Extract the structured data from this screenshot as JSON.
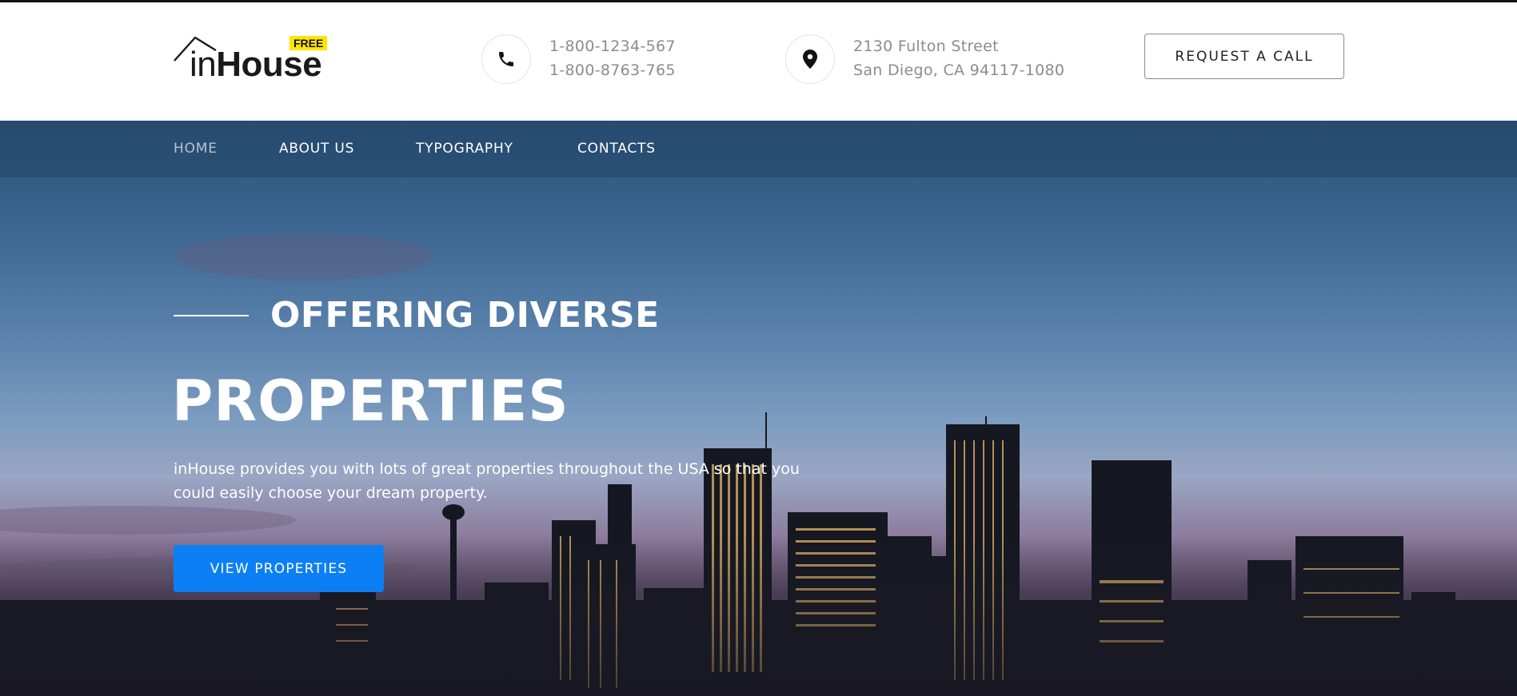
{
  "logo": {
    "light": "in",
    "bold": "House",
    "badge": "FREE"
  },
  "contact": {
    "phone_icon": "phone-icon",
    "phones": [
      "1-800-1234-567",
      "1-800-8763-765"
    ],
    "location_icon": "map-pin-icon",
    "address": [
      "2130 Fulton Street",
      "San Diego, CA 94117-1080"
    ]
  },
  "header": {
    "request_label": "REQUEST A CALL"
  },
  "nav": {
    "items": [
      {
        "label": "HOME",
        "active": true
      },
      {
        "label": "ABOUT US",
        "active": false
      },
      {
        "label": "TYPOGRAPHY",
        "active": false
      },
      {
        "label": "CONTACTS",
        "active": false
      }
    ]
  },
  "hero": {
    "kicker": "OFFERING DIVERSE",
    "title": "PROPERTIES",
    "description": "inHouse provides you with lots of great properties throughout the USA so that you could easily choose your dream property.",
    "button_label": "VIEW PROPERTIES"
  },
  "colors": {
    "accent": "#0d7ff5",
    "badge": "#ffe600",
    "nav_active": "#b7c3cf"
  }
}
